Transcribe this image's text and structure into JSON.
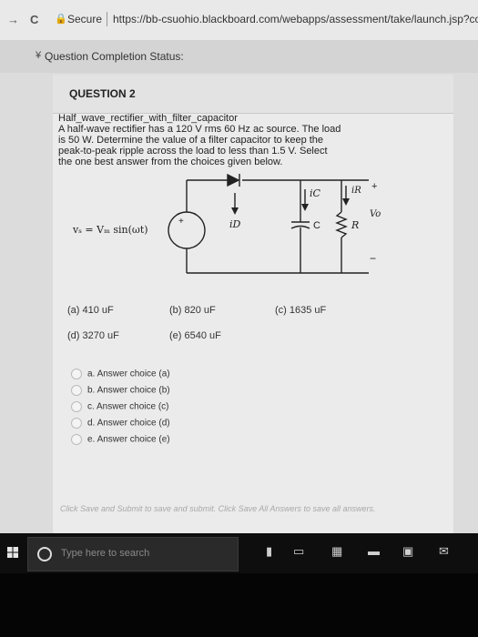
{
  "browser": {
    "back": "→",
    "reload": "C",
    "secure_label": "Secure",
    "url": "https://bb-csuohio.blackboard.com/webapps/assessment/take/launch.jsp?co"
  },
  "status": {
    "label": "Question Completion Status:"
  },
  "question": {
    "heading": "QUESTION 2",
    "lines": [
      "Half_wave_rectifier_with_filter_capacitor",
      "A half-wave rectifier has a 120 V rms 60 Hz ac source.  The load",
      "is 50 W.  Determine the value of a filter capacitor to keep the",
      "peak-to-peak ripple across the load to less than 1.5 V.  Select",
      "the one best answer from the choices given below."
    ],
    "circuit": {
      "source_eq": "vₛ = Vₘ sin(ωt)",
      "plus": "+",
      "i_d": "iD",
      "i_c": "iC",
      "i_r": "iR",
      "cap": "C",
      "res": "R",
      "vo": "Vo",
      "out_plus": "+",
      "out_minus": "−"
    },
    "choices": [
      {
        "label": "(a)  410 uF"
      },
      {
        "label": "(b)  820 uF"
      },
      {
        "label": "(c)  1635 uF"
      },
      {
        "label": "(d)  3270 uF"
      },
      {
        "label": "(e)  6540 uF"
      }
    ],
    "options": [
      "a. Answer choice (a)",
      "b. Answer choice (b)",
      "c. Answer choice (c)",
      "d. Answer choice (d)",
      "e. Answer choice (e)"
    ]
  },
  "footer_note": "Click Save and Submit to save and submit. Click Save All Answers to save all answers.",
  "taskbar": {
    "search_placeholder": "Type here to search"
  }
}
